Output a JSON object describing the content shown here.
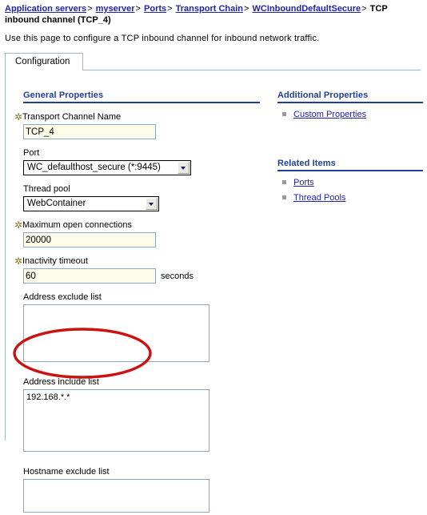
{
  "breadcrumb": {
    "items": [
      {
        "label": "Application servers",
        "link": true
      },
      {
        "label": "myserver",
        "link": true
      },
      {
        "label": "Ports",
        "link": true
      },
      {
        "label": "Transport Chain",
        "link": true
      },
      {
        "label": "WCInboundDefaultSecure",
        "link": true
      },
      {
        "label": "TCP inbound channel (TCP_4)",
        "link": false
      }
    ],
    "separator": ">"
  },
  "intro": {
    "text": "Use this page to configure a TCP inbound channel for inbound network traffic."
  },
  "tabs": [
    {
      "label": "Configuration",
      "active": true
    }
  ],
  "main": {
    "section_title": "General Properties",
    "fields": {
      "transport_channel_name": {
        "label": "Transport Channel Name",
        "required": true,
        "value": "TCP_4"
      },
      "port": {
        "label": "Port",
        "required": false,
        "value": "WC_defaulthost_secure (*:9445)",
        "options": [
          "WC_defaulthost_secure (*:9445)"
        ]
      },
      "thread_pool": {
        "label": "Thread pool",
        "required": false,
        "value": "WebContainer",
        "options": [
          "WebContainer"
        ]
      },
      "maximum_open_connections": {
        "label": "Maximum open connections",
        "required": true,
        "value": "20000"
      },
      "inactivity_timeout": {
        "label": "Inactivity timeout",
        "required": true,
        "value": "60",
        "unit": "seconds"
      },
      "address_exclude_list": {
        "label": "Address exclude list",
        "required": false,
        "value": ""
      },
      "address_include_list": {
        "label": "Address include list",
        "required": false,
        "value": "192.168.*.*"
      },
      "hostname_exclude_list": {
        "label": "Hostname exclude list",
        "required": false,
        "value": ""
      }
    },
    "required_marker": "✲"
  },
  "sidebar": {
    "additional_properties": {
      "title": "Additional Properties",
      "links": [
        {
          "label": "Custom Properties"
        }
      ]
    },
    "related_items": {
      "title": "Related Items",
      "links": [
        {
          "label": "Ports"
        },
        {
          "label": "Thread Pools"
        }
      ]
    }
  },
  "annotation": {
    "type": "ellipse-highlight",
    "color": "#cc1111",
    "target": "Address include list"
  },
  "colors": {
    "link": "#2222aa",
    "section_heading": "#21409a",
    "required_star": "#8a7a18",
    "field_background": "#fbfbe8",
    "field_border": "#8ba9c4",
    "tab_border": "#9bb7d4",
    "annotation": "#cc1111"
  }
}
